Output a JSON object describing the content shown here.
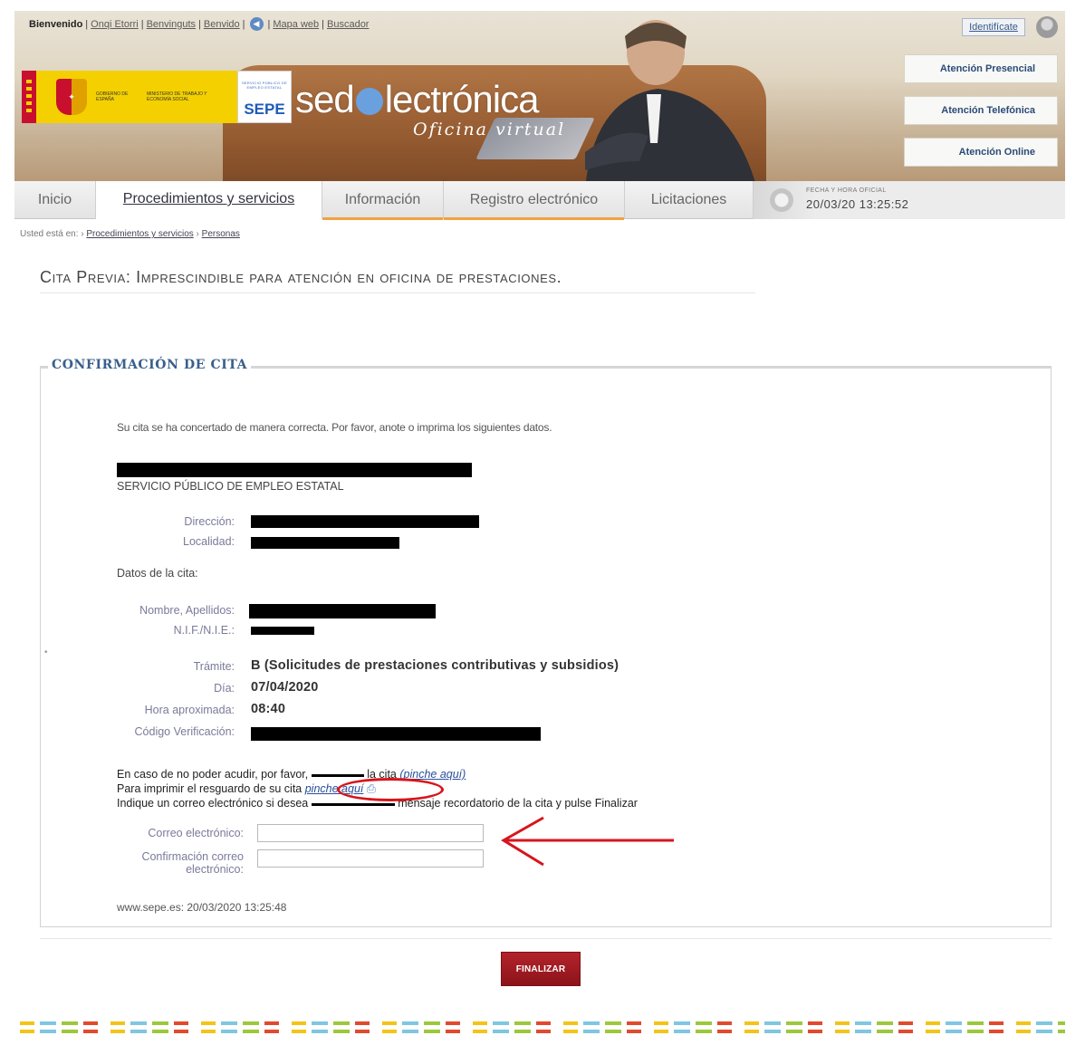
{
  "header": {
    "top_links": {
      "welcome": "Bienvenido",
      "items": [
        "Onqi Etorri",
        "Benvinguts",
        "Benvido",
        "Mapa web",
        "Buscador"
      ]
    },
    "identify_label": "Identifícate",
    "identify_icon": "user-icon",
    "speaker_icon": "speaker-icon",
    "gov_text": "GOBIERNO DE ESPAÑA",
    "ministry_text": "MINISTERIO DE TRABAJO Y ECONOMÍA SOCIAL",
    "sepe_small": "SERVICIO PÚBLICO DE EMPLEO ESTATAL",
    "sepe_acronym": "SEPE",
    "sede_left": "sed",
    "sede_right": "lectrónica",
    "oficina": "Oficina virtual",
    "attention": [
      "Atención Presencial",
      "Atención Telefónica",
      "Atención Online"
    ]
  },
  "nav": {
    "tabs": [
      "Inicio",
      "Procedimientos y servicios",
      "Información",
      "Registro electrónico",
      "Licitaciones"
    ],
    "datetime_label": "FECHA Y HORA OFICIAL",
    "datetime_value": "20/03/20     13:25:52"
  },
  "breadcrumb": {
    "prefix": "Usted está en: ›",
    "items": [
      "Procedimientos y servicios",
      "Personas"
    ]
  },
  "page": {
    "title_first": "Cita Previa",
    "title_rest": ": Imprescindible para atención en oficina de prestaciones."
  },
  "confirmation": {
    "legend": "CONFIRMACIÓN DE CITA",
    "intro": "Su cita se ha concertado de manera correcta. Por favor, anote o imprima los siguientes datos.",
    "service": "SERVICIO PÚBLICO DE EMPLEO ESTATAL",
    "labels": {
      "direccion": "Dirección:",
      "localidad": "Localidad:",
      "datos": "Datos de la cita:",
      "nombre": "Nombre, Apellidos:",
      "nif": "N.I.F./N.I.E.:",
      "tramite": "Trámite:",
      "dia": "Día:",
      "hora": "Hora aproximada:",
      "codigo": "Código Verificación:"
    },
    "values": {
      "tramite": "B (Solicitudes de prestaciones contributivas y subsidios)",
      "dia": "07/04/2020",
      "hora": "08:40"
    },
    "notes": {
      "line1_text": "En caso de no poder acudir, por favor,",
      "line1_tail": "la cita",
      "line1_link": "(pinche aquí)",
      "line2_text": "Para imprimir el resguardo de su cita",
      "line2_link": "pinche aquí",
      "line3_head": "Indique un correo electrónico si desea",
      "line3_tail": "mensaje recordatorio de la cita y pulse Finalizar"
    },
    "email_label": "Correo electrónico:",
    "email_value": "",
    "confirm_label_1": "Confirmación correo",
    "confirm_label_2": "electrónico:",
    "confirm_value": "",
    "stamp": "www.sepe.es: 20/03/2020 13:25:48"
  },
  "actions": {
    "finish_label": "FINALIZAR"
  },
  "colors": {
    "accent": "#3a5f8a",
    "button": "#a11d24",
    "annotation": "#d8141c"
  }
}
